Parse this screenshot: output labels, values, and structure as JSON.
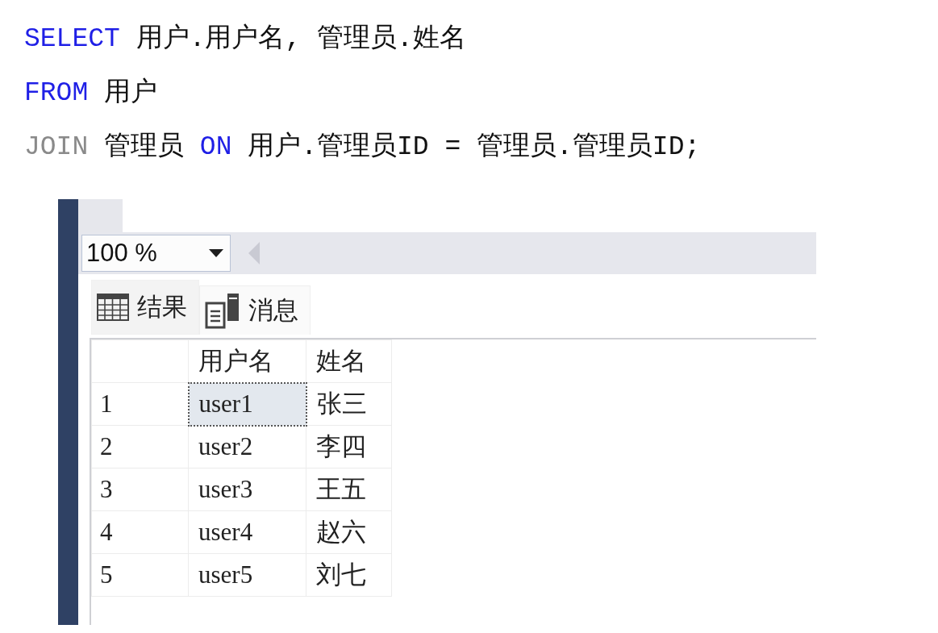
{
  "code": [
    {
      "tokens": [
        {
          "kind": "keyword",
          "text": "SELECT"
        },
        {
          "kind": "text",
          "text": " 用户.用户名, 管理员.姓名"
        }
      ]
    },
    {
      "tokens": [
        {
          "kind": "keyword",
          "text": "FROM"
        },
        {
          "kind": "text",
          "text": " 用户"
        }
      ]
    },
    {
      "tokens": [
        {
          "kind": "muted",
          "text": "JOIN"
        },
        {
          "kind": "text",
          "text": " 管理员 "
        },
        {
          "kind": "keyword",
          "text": "ON"
        },
        {
          "kind": "text",
          "text": " 用户.管理员ID = 管理员.管理员ID;"
        }
      ]
    }
  ],
  "zoom": {
    "value": "100 %"
  },
  "tabs": [
    {
      "label": "结果",
      "kind": "grid",
      "selected": true
    },
    {
      "label": "消息",
      "kind": "messages",
      "selected": false
    }
  ],
  "table": {
    "columns": [
      "用户名",
      "姓名"
    ],
    "rows": [
      {
        "number": "1",
        "cells": [
          "user1",
          "张三"
        ],
        "selected": true
      },
      {
        "number": "2",
        "cells": [
          "user2",
          "李四"
        ],
        "selected": false
      },
      {
        "number": "3",
        "cells": [
          "user3",
          "王五"
        ],
        "selected": false
      },
      {
        "number": "4",
        "cells": [
          "user4",
          "赵六"
        ],
        "selected": false
      },
      {
        "number": "5",
        "cells": [
          "user5",
          "刘七"
        ],
        "selected": false
      }
    ]
  }
}
